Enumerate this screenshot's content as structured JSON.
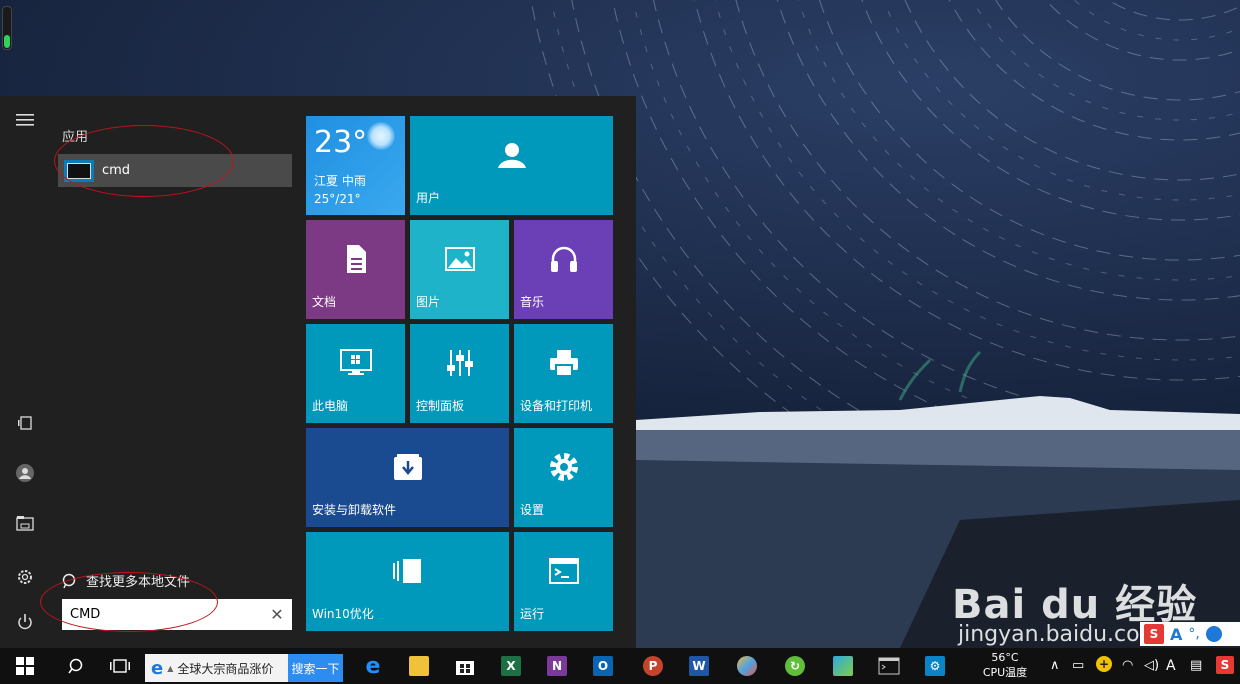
{
  "start_menu": {
    "apps_header": "应用",
    "result_label": "cmd",
    "search_more": "查找更多本地文件",
    "search_value": "CMD"
  },
  "tiles": {
    "weather": {
      "temp": "23°",
      "location": "江夏  中雨",
      "range": "25°/21°"
    },
    "user": "用户",
    "documents": "文档",
    "pictures": "图片",
    "music": "音乐",
    "this_pc": "此电脑",
    "control_panel": "控制面板",
    "devices_printers": "设备和打印机",
    "install_uninstall": "安装与卸载软件",
    "settings": "设置",
    "win10_optimize": "Win10优化",
    "run": "运行"
  },
  "taskbar": {
    "ie_search_text": "全球大宗商品涨价",
    "ie_search_button": "搜索一下",
    "cpu_temp": "56°C",
    "cpu_label": "CPU温度",
    "ime_label": "A"
  },
  "watermark": {
    "logo": "Bai du 经验",
    "url": "jingyan.baidu.com"
  },
  "colors": {
    "tile_blue": "#0099bc",
    "tile_purple": "#7b3a83",
    "tile_violet": "#6b3fb5",
    "tile_navy": "#1a4a8f",
    "annotation_red": "#c0141c"
  }
}
